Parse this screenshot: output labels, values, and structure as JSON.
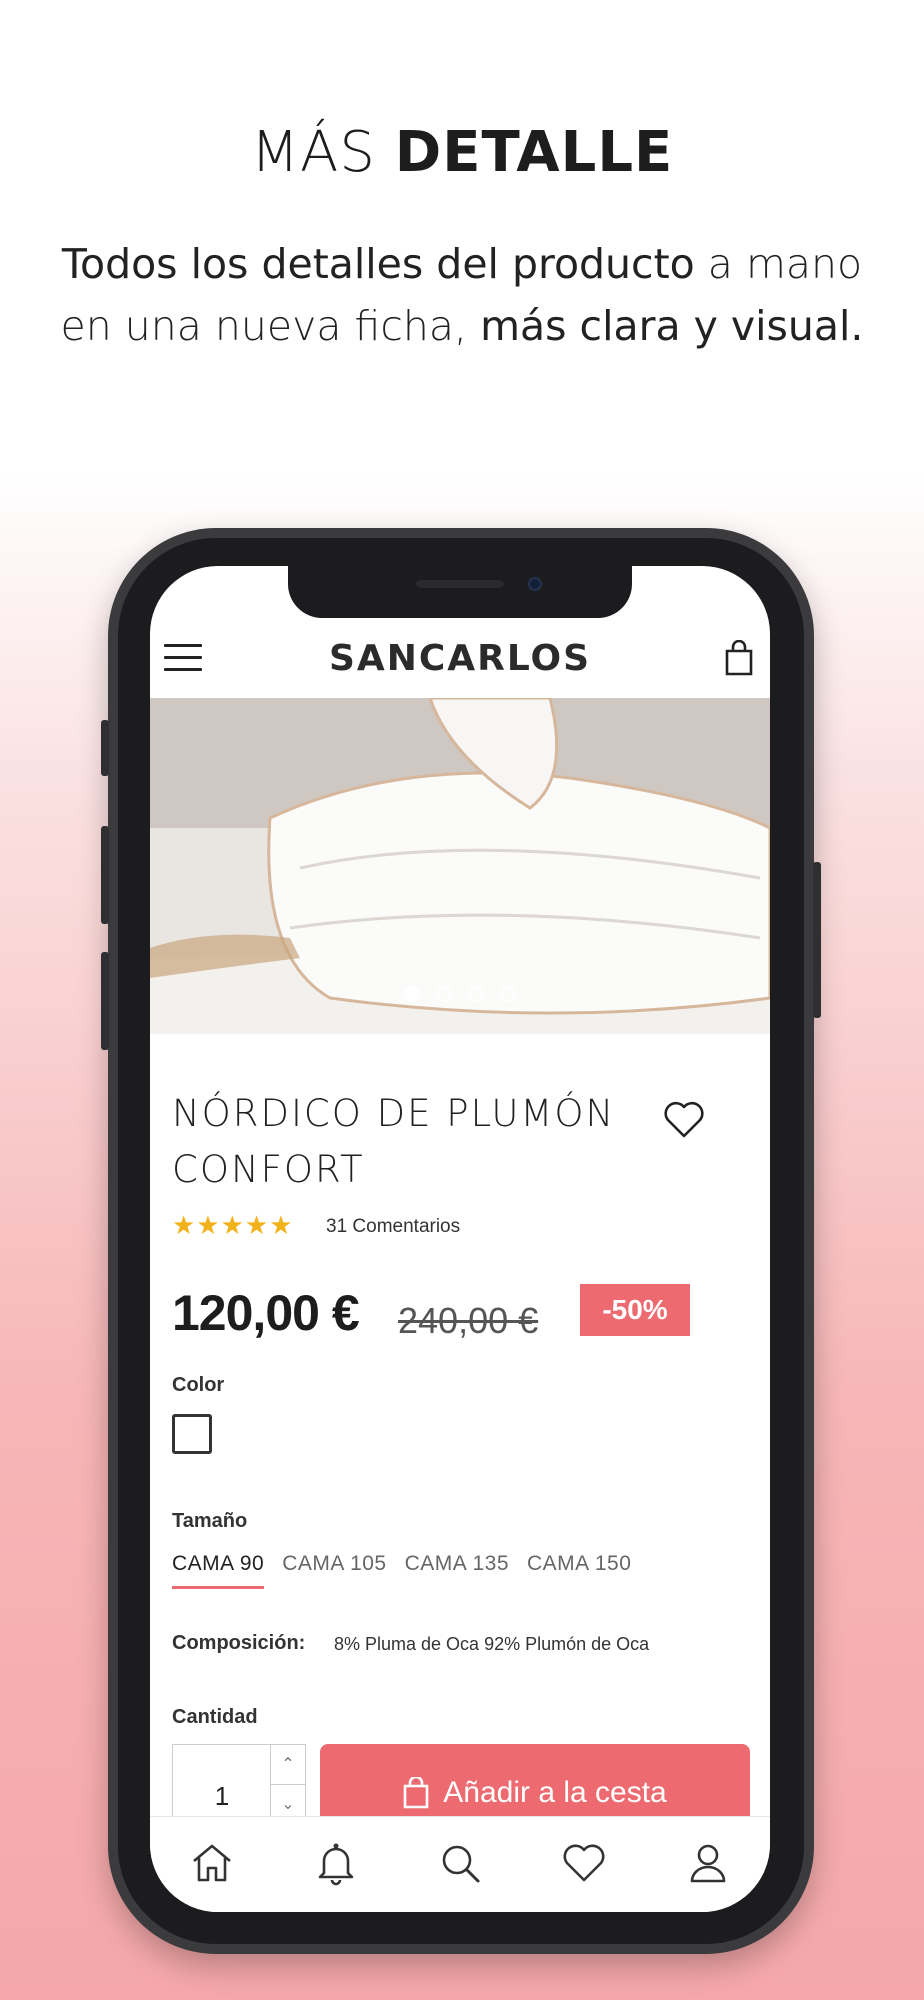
{
  "promo": {
    "title_light": "MÁS",
    "title_bold": "DETALLE",
    "subtitle_bold_1": "Todos los detalles del producto",
    "subtitle_light_1": " a mano en una nueva ficha, ",
    "subtitle_bold_2": "más clara y visual."
  },
  "app": {
    "brand": "SANCARLOS",
    "carousel": {
      "count": 4,
      "active": 1
    }
  },
  "product": {
    "title": "NÓRDICO DE PLUMÓN CONFORT",
    "rating": 4.5,
    "rating_stars": "★★★★★",
    "reviews": "31 Comentarios",
    "price": "120,00 €",
    "old_price": "240,00 €",
    "discount": "-50%",
    "color_label": "Color",
    "size_label": "Tamaño",
    "sizes": [
      "CAMA 90",
      "CAMA 105",
      "CAMA 135",
      "CAMA 150"
    ],
    "selected_size": "CAMA 90",
    "composition_label": "Composición:",
    "composition_value": "8% Pluma de Oca 92% Plumón de Oca",
    "quantity_label": "Cantidad",
    "quantity": "1",
    "add_to_cart": "Añadir a la cesta"
  },
  "nav": {
    "items": [
      "home-icon",
      "bell-icon",
      "search-icon",
      "heart-icon",
      "user-icon"
    ]
  },
  "colors": {
    "accent": "#ed6b70",
    "star": "#f2b21c"
  }
}
